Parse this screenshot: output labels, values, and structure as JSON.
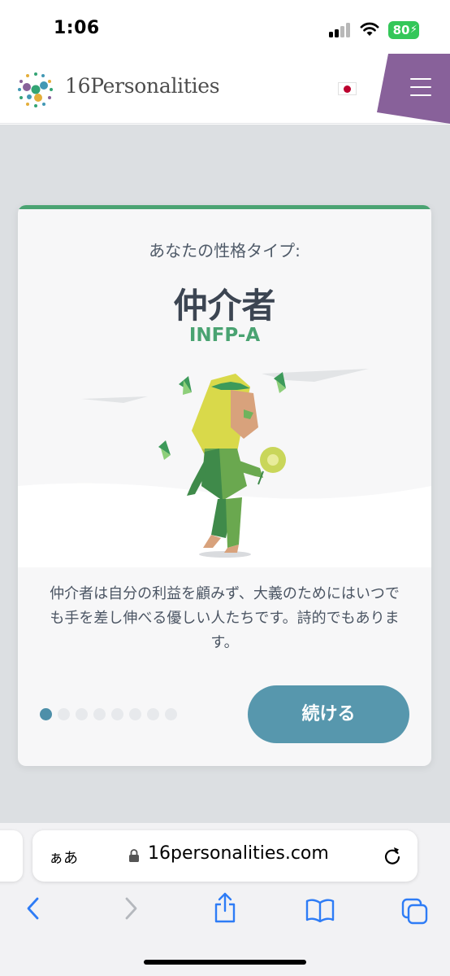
{
  "status_bar": {
    "time": "1:06",
    "battery": "80"
  },
  "header": {
    "logo_text": "16Personalities",
    "language_flag": "japan-flag",
    "menu_icon": "hamburger-icon",
    "accent_color": "#88619a"
  },
  "result_card": {
    "label": "あなたの性格タイプ:",
    "type_name": "仲介者",
    "type_code": "INFP-A",
    "description": "仲介者は自分の利益を顧みず、大義のためにはいつでも手を差し伸べる優しい人たちです。詩的でもあります。",
    "continue_button": "続ける",
    "progress": {
      "current": 1,
      "total": 8
    },
    "accent_color": "#4aa372",
    "button_color": "#5797ad"
  },
  "browser": {
    "text_size_button": "ぁあ",
    "url": "16personalities.com",
    "toolbar_icons": [
      "back-icon",
      "forward-icon",
      "share-icon",
      "bookmarks-icon",
      "tabs-icon"
    ]
  }
}
